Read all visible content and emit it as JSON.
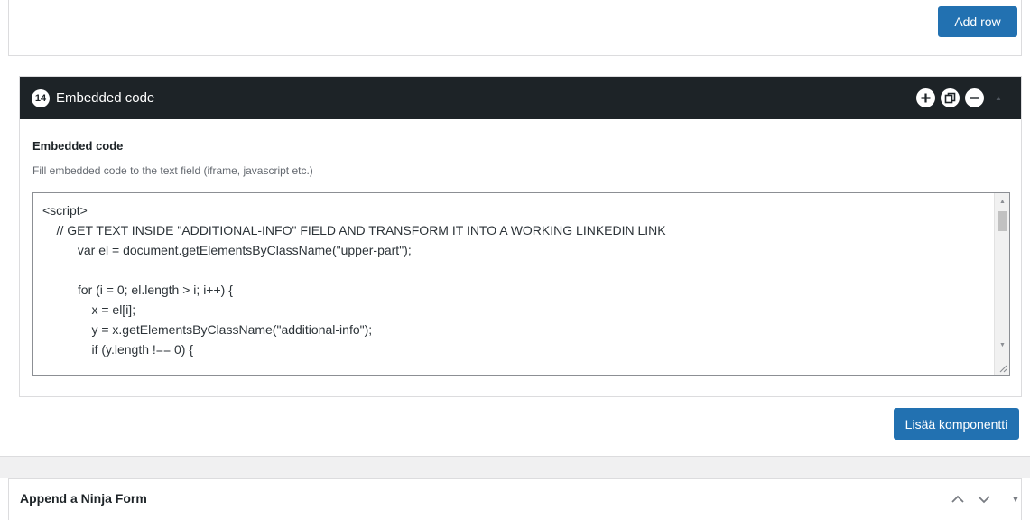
{
  "prev_panel": {
    "add_row_label": "Add row"
  },
  "component": {
    "number": "14",
    "title": "Embedded code",
    "field_label": "Embedded code",
    "field_description": "Fill embedded code to the text field (iframe, javascript etc.)",
    "code_lines": [
      "<script>",
      "    // GET TEXT INSIDE \"ADDITIONAL-INFO\" FIELD AND TRANSFORM IT INTO A WORKING LINKEDIN LINK",
      "          var el = document.getElementsByClassName(\"upper-part\");",
      "",
      "          for (i = 0; el.length > i; i++) {",
      "              x = el[i];",
      "              y = x.getElementsByClassName(\"additional-info\");",
      "              if (y.length !== 0) {"
    ],
    "icons": [
      "plus-circle-icon",
      "duplicate-icon",
      "minus-circle-icon",
      "collapse-arrow-icon"
    ]
  },
  "add_component_label": "Lisää komponentti",
  "ninja_panel": {
    "title": "Append a Ninja Form",
    "icons": [
      "chevron-up-icon",
      "chevron-down-icon",
      "triangle-down-icon"
    ]
  },
  "colors": {
    "header_bg": "#1d2327",
    "button_bg": "#2271b1"
  }
}
